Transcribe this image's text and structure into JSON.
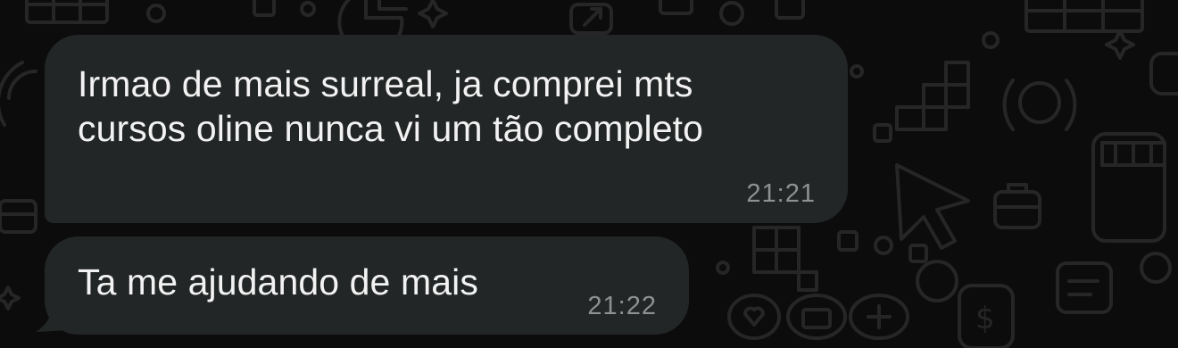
{
  "theme": {
    "background": "#0c0c0c",
    "bubble_color": "#232626",
    "text_color": "#f2f2f2",
    "time_color": "#8e9191",
    "doodle_color": "#2a2a2a"
  },
  "messages": [
    {
      "line1": "Irmao de mais surreal, ja comprei mts",
      "line2": "cursos oline nunca vi um tão completo",
      "time": "21:21"
    },
    {
      "line1": "Ta me ajudando de mais",
      "time": "21:22"
    }
  ],
  "wallpaper": {
    "icons": [
      "grid-icon",
      "pie-chart-icon",
      "arrow-up-icon",
      "sparkle-icon",
      "briefcase-icon",
      "cursor-arrow-icon",
      "heart-icon",
      "plus-icon",
      "dollar-icon",
      "note-icon",
      "phone-icon",
      "store-icon",
      "squares-icon"
    ]
  }
}
